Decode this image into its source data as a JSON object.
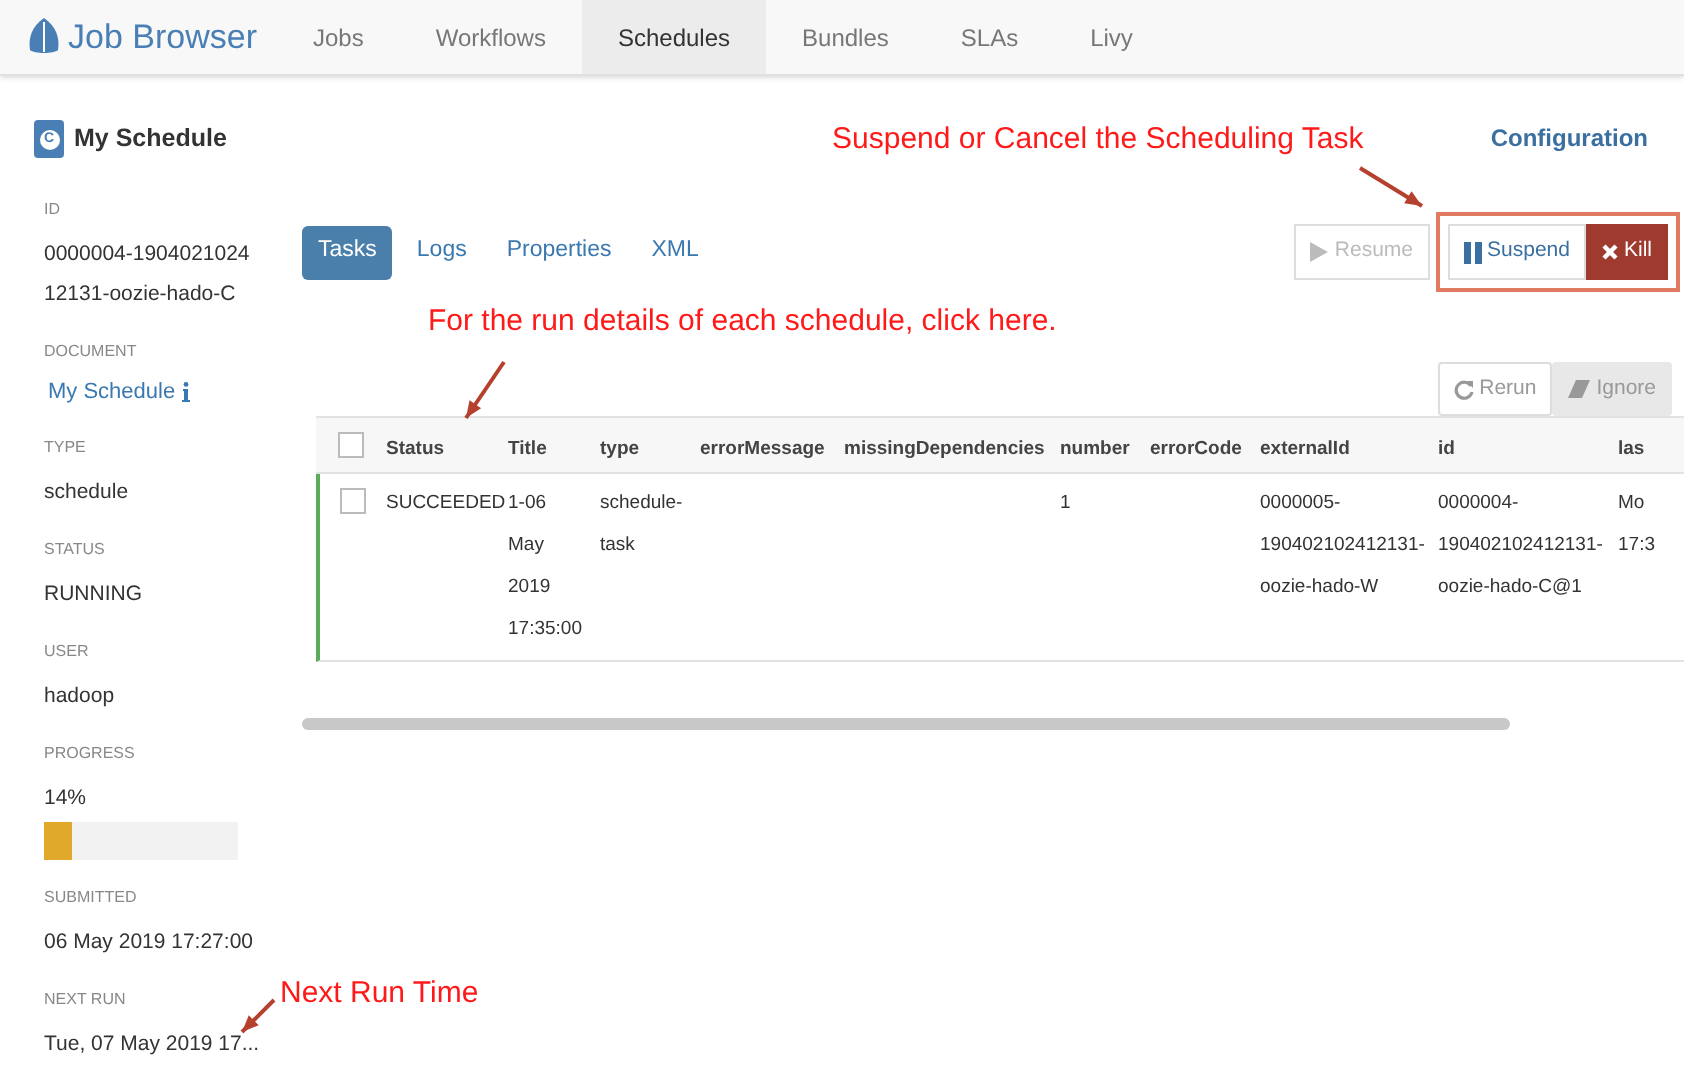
{
  "navbar": {
    "brand": "Job Browser",
    "items": [
      {
        "label": "Jobs",
        "selected": false
      },
      {
        "label": "Workflows",
        "selected": false
      },
      {
        "label": "Schedules",
        "selected": true
      },
      {
        "label": "Bundles",
        "selected": false
      },
      {
        "label": "SLAs",
        "selected": false
      },
      {
        "label": "Livy",
        "selected": false
      }
    ]
  },
  "header": {
    "badge": "C",
    "title": "My Schedule",
    "link": "Configuration"
  },
  "sidebar": [
    {
      "kind": "text",
      "label": "ID",
      "value": "0000004-190402102412131-oozie-hado-C"
    },
    {
      "kind": "link",
      "label": "DOCUMENT",
      "value": "My Schedule"
    },
    {
      "kind": "text",
      "label": "TYPE",
      "value": "schedule"
    },
    {
      "kind": "text",
      "label": "STATUS",
      "value": "RUNNING"
    },
    {
      "kind": "text",
      "label": "USER",
      "value": "hadoop"
    },
    {
      "kind": "progress",
      "label": "PROGRESS",
      "value": "14%",
      "level": 0.14
    },
    {
      "kind": "text",
      "label": "SUBMITTED",
      "value": "06 May 2019 17:27:00"
    },
    {
      "kind": "text",
      "label": "NEXT RUN",
      "value": "Tue, 07 May 2019 17..."
    }
  ],
  "tabs": [
    {
      "label": "Tasks",
      "selected": true
    },
    {
      "label": "Logs",
      "selected": false
    },
    {
      "label": "Properties",
      "selected": false
    },
    {
      "label": "XML",
      "selected": false
    }
  ],
  "actions": [
    {
      "kind": "resume",
      "label": "Resume",
      "disabled": true
    },
    {
      "kind": "suspend",
      "label": "Suspend",
      "disabled": false
    },
    {
      "kind": "kill",
      "label": "Kill",
      "disabled": false
    }
  ],
  "table_actions": [
    {
      "kind": "rerun",
      "label": "Rerun",
      "disabled": true
    },
    {
      "kind": "ignore",
      "label": "Ignore",
      "disabled": true
    }
  ],
  "table": {
    "checked": false,
    "columns": [
      "Status",
      "Title",
      "type",
      "errorMessage",
      "missingDependencies",
      "number",
      "errorCode",
      "externalId",
      "id",
      "las"
    ],
    "rows": [
      {
        "checked": false,
        "cells": [
          "SUCCEEDED",
          "1-06 May 2019 17:35:00",
          "schedule-task",
          "",
          "",
          "1",
          "",
          "0000005-190402102412131-oozie-hado-W",
          "0000004-190402102412131-oozie-hado-C@1",
          "Mo 17:3"
        ]
      }
    ]
  },
  "annotations": [
    "Suspend or Cancel the Scheduling Task",
    "For the run details of each schedule, click here.",
    "Next Run Time"
  ]
}
